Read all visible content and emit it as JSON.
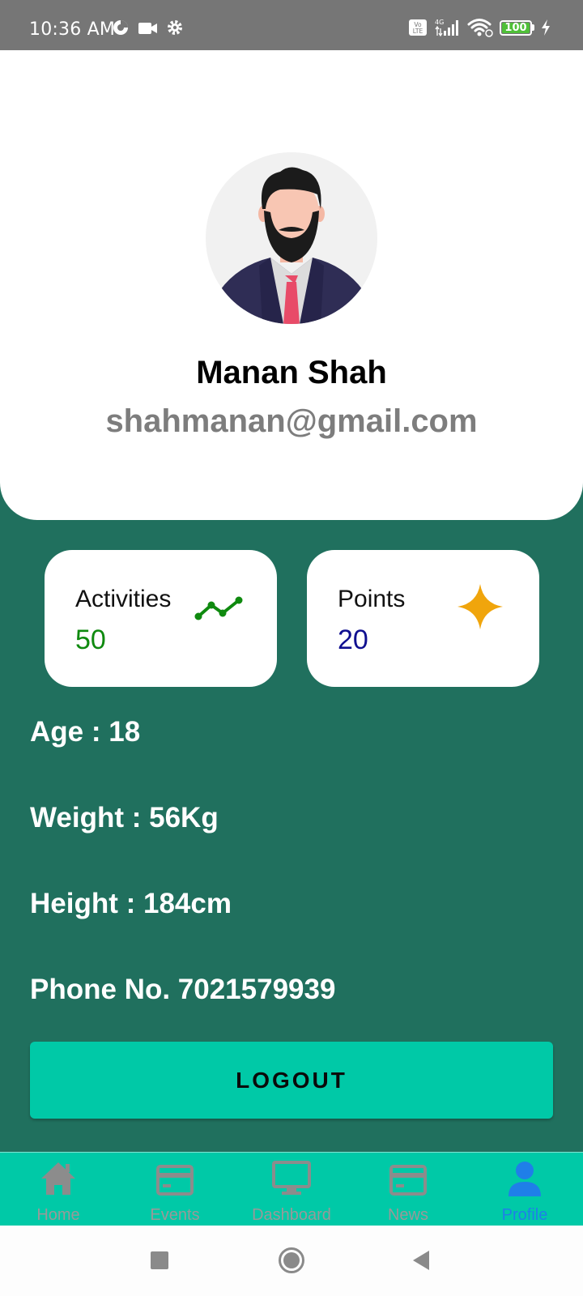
{
  "status_bar": {
    "time": "10:36 AM",
    "battery": "100",
    "icons": [
      "data-saver-icon",
      "video-camera-icon",
      "gear-icon",
      "volte-icon",
      "4g-signal-icon",
      "wifi-icon",
      "battery-icon",
      "charging-icon"
    ]
  },
  "profile": {
    "name": "Manan Shah",
    "email": "shahmanan@gmail.com",
    "avatar_icon": "user-avatar-illustration"
  },
  "stats": {
    "activities": {
      "label": "Activities",
      "value": "50",
      "color": "#0f8a0f",
      "icon": "trending-line-icon"
    },
    "points": {
      "label": "Points",
      "value": "20",
      "color": "#101090",
      "icon": "sparkle-star-icon"
    }
  },
  "details": {
    "age": "Age : 18",
    "weight": "Weight : 56Kg",
    "height": "Height : 184cm",
    "phone": "Phone No. 7021579939"
  },
  "logout_label": "LOGOUT",
  "bottom_nav": {
    "items": [
      {
        "label": "Home",
        "icon": "home-icon"
      },
      {
        "label": "Events",
        "icon": "card-icon"
      },
      {
        "label": "Dashboard",
        "icon": "monitor-icon"
      },
      {
        "label": "News",
        "icon": "card-icon"
      },
      {
        "label": "Profile",
        "icon": "person-icon",
        "active": true
      }
    ]
  },
  "system_nav": [
    "recents-button",
    "home-button",
    "back-button"
  ],
  "colors": {
    "background": "#20705e",
    "accent": "#00c9a7",
    "active_nav": "#1f7fe8",
    "status_bar": "#767676"
  }
}
